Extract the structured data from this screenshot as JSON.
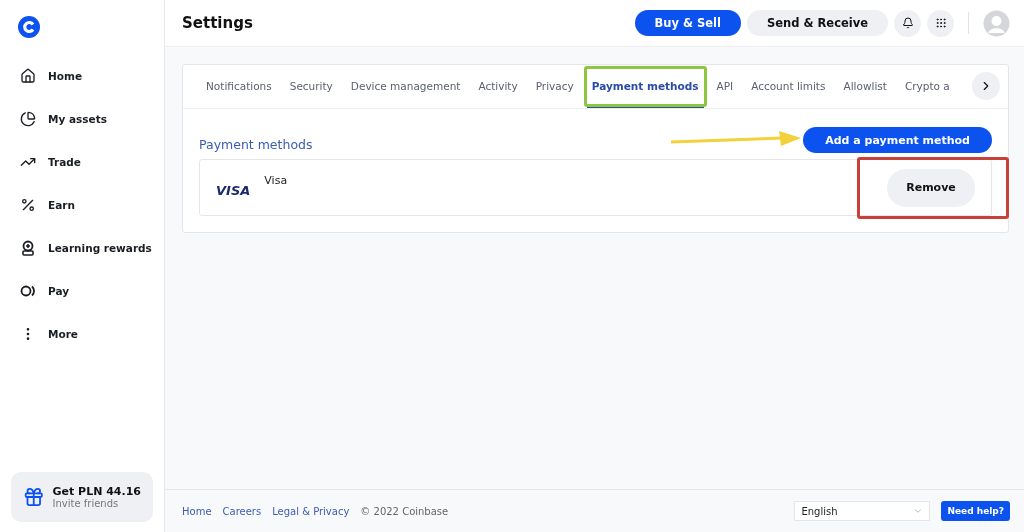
{
  "header": {
    "title": "Settings",
    "buy_sell": "Buy & Sell",
    "send_receive": "Send & Receive"
  },
  "sidebar": {
    "items": [
      {
        "kind": "home",
        "label": "Home"
      },
      {
        "kind": "assets",
        "label": "My assets"
      },
      {
        "kind": "trade",
        "label": "Trade"
      },
      {
        "kind": "earn",
        "label": "Earn"
      },
      {
        "kind": "learn",
        "label": "Learning rewards"
      },
      {
        "kind": "pay",
        "label": "Pay"
      },
      {
        "kind": "more",
        "label": "More"
      }
    ],
    "promo": {
      "title": "Get PLN 44.16",
      "subtitle": "Invite friends"
    }
  },
  "tabs": [
    {
      "label": "Notifications",
      "selected": false,
      "outlined": false
    },
    {
      "label": "Security",
      "selected": false,
      "outlined": false
    },
    {
      "label": "Device management",
      "selected": false,
      "outlined": false
    },
    {
      "label": "Activity",
      "selected": false,
      "outlined": false
    },
    {
      "label": "Privacy",
      "selected": false,
      "outlined": false
    },
    {
      "label": "Payment methods",
      "selected": true,
      "outlined": true
    },
    {
      "label": "API",
      "selected": false,
      "outlined": false
    },
    {
      "label": "Account limits",
      "selected": false,
      "outlined": false
    },
    {
      "label": "Allowlist",
      "selected": false,
      "outlined": false
    },
    {
      "label": "Crypto a",
      "selected": false,
      "outlined": false
    }
  ],
  "section": {
    "title": "Payment methods",
    "add_button": {
      "label": "Add a payment method",
      "pointed_at": true
    },
    "methods": [
      {
        "brand": "VISA",
        "name": "Visa",
        "remove": {
          "label": "Remove",
          "outlined": true
        }
      }
    ]
  },
  "footer": {
    "links": [
      "Home",
      "Careers",
      "Legal & Privacy"
    ],
    "copyright": "© 2022 Coinbase",
    "language": "English",
    "help": "Need help?"
  }
}
